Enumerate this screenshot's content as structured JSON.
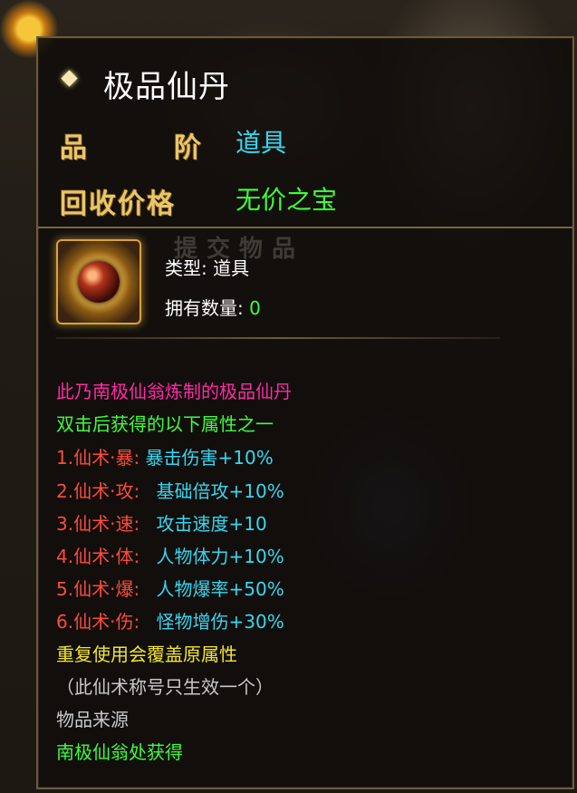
{
  "title": "极品仙丹",
  "header": {
    "grade_label_1": "品",
    "grade_label_2": "阶",
    "grade_value": "道具",
    "recycle_label": "回收价格",
    "recycle_value": "无价之宝"
  },
  "watermark": "提交物品",
  "info": {
    "type_label": "类型:",
    "type_value": "道具",
    "count_label": "拥有数量:",
    "count_value": "0"
  },
  "desc": {
    "line1": "此乃南极仙翁炼制的极品仙丹",
    "line2": "双击后获得的以下属性之一",
    "attrs": [
      {
        "name": "1.仙术·暴:",
        "effect": "暴击伤害+10%"
      },
      {
        "name": "2.仙术·攻:",
        "effect": "基础倍攻+10%"
      },
      {
        "name": "3.仙术·速:",
        "effect": "攻击速度+10"
      },
      {
        "name": "4.仙术·体:",
        "effect": "人物体力+10%"
      },
      {
        "name": "5.仙术·爆:",
        "effect": "人物爆率+50%"
      },
      {
        "name": "6.仙术·伤:",
        "effect": "怪物增伤+30%"
      }
    ],
    "note1": "重复使用会覆盖原属性",
    "note2": "（此仙术称号只生效一个）",
    "source_label": "物品来源",
    "source_value": "南极仙翁处获得"
  },
  "colors": {
    "title": "#ffffff",
    "label_gold": "#e9c66a",
    "cyan": "#37d7f0",
    "green": "#3cff3a",
    "magenta": "#ff2aa6",
    "red": "#ff4b3a",
    "yellow": "#f3e62b",
    "gray": "#c9c9c9"
  }
}
